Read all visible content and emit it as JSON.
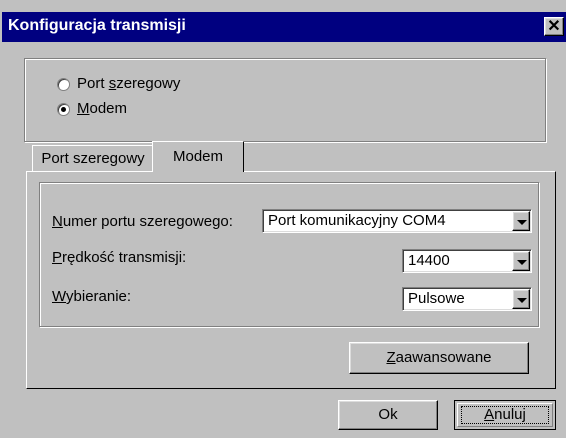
{
  "window": {
    "title": "Konfiguracja transmisji",
    "close_symbol": "✕",
    "title_bar_color": "#000080",
    "face_color": "#c0c0c0"
  },
  "mode": {
    "options": [
      {
        "before": "Port ",
        "mnemonic": "s",
        "after": "zeregowy",
        "selected": false
      },
      {
        "before": "",
        "mnemonic": "M",
        "after": "odem",
        "selected": true
      }
    ]
  },
  "tabs": {
    "serial_label": "Port szeregowy",
    "modem_label": "Modem",
    "active": "Modem"
  },
  "modem_settings": {
    "port": {
      "label_mnemonic": "N",
      "label_rest": "umer portu szeregowego:",
      "value": "Port komunikacyjny COM4"
    },
    "speed": {
      "label_mnemonic": "P",
      "label_rest": "rędkość transmisji:",
      "value": "14400"
    },
    "dialing": {
      "label_mnemonic": "W",
      "label_rest": "ybieranie:",
      "value": "Pulsowe"
    },
    "advanced": {
      "mnemonic": "Z",
      "rest": "aawansowane"
    }
  },
  "buttons": {
    "ok": "Ok",
    "cancel_mnemonic": "A",
    "cancel_rest": "nuluj"
  },
  "icons": {
    "close": "close-icon",
    "dropdown": "chevron-down-icon"
  }
}
